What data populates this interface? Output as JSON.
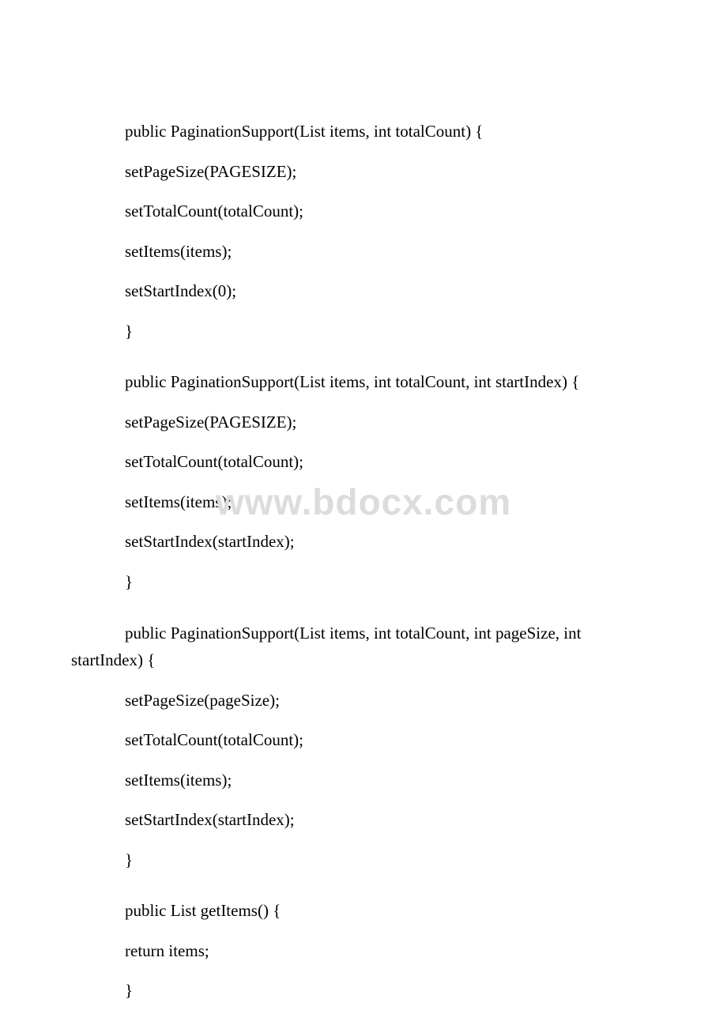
{
  "watermark": "www.bdocx.com",
  "code": {
    "block1": {
      "l1": "public PaginationSupport(List items, int totalCount) {",
      "l2": "setPageSize(PAGESIZE);",
      "l3": "setTotalCount(totalCount);",
      "l4": "setItems(items);",
      "l5": "setStartIndex(0);",
      "l6": "}"
    },
    "block2": {
      "l1": "public PaginationSupport(List items, int totalCount, int startIndex) {",
      "l2": "setPageSize(PAGESIZE);",
      "l3": "setTotalCount(totalCount);",
      "l4": "setItems(items);",
      "l5": "setStartIndex(startIndex);",
      "l6": "}"
    },
    "block3": {
      "l1a": "public PaginationSupport(List items, int totalCount, int pageSize, int",
      "l1b": "startIndex) {",
      "l2": "setPageSize(pageSize);",
      "l3": "setTotalCount(totalCount);",
      "l4": "setItems(items);",
      "l5": "setStartIndex(startIndex);",
      "l6": "}"
    },
    "block4": {
      "l1": "public List getItems() {",
      "l2": "return items;",
      "l3": "}"
    }
  }
}
